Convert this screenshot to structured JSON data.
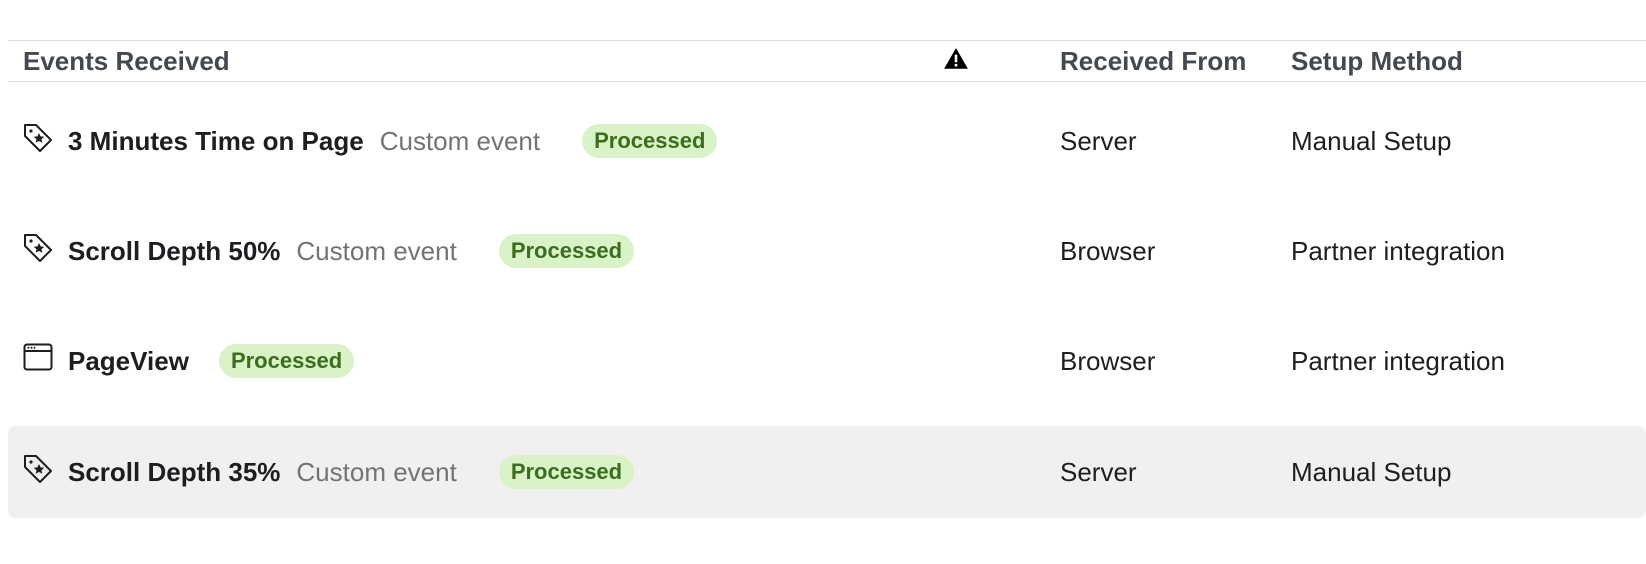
{
  "table": {
    "headers": {
      "events_received": "Events Received",
      "warning_icon": "warning-triangle-icon",
      "received_from": "Received From",
      "setup_method": "Setup Method"
    },
    "rows": [
      {
        "icon": "custom-event-tag-icon",
        "name": "3 Minutes Time on Page",
        "type": "Custom event",
        "status": "Processed",
        "received_from": "Server",
        "setup_method": "Manual Setup",
        "highlighted": false
      },
      {
        "icon": "custom-event-tag-icon",
        "name": "Scroll Depth 50%",
        "type": "Custom event",
        "status": "Processed",
        "received_from": "Browser",
        "setup_method": "Partner integration",
        "highlighted": false
      },
      {
        "icon": "browser-window-icon",
        "name": "PageView",
        "type": "",
        "status": "Processed",
        "received_from": "Browser",
        "setup_method": "Partner integration",
        "highlighted": false
      },
      {
        "icon": "custom-event-tag-icon",
        "name": "Scroll Depth 35%",
        "type": "Custom event",
        "status": "Processed",
        "received_from": "Server",
        "setup_method": "Manual Setup",
        "highlighted": true
      }
    ]
  },
  "colors": {
    "badge_bg": "#d9f2c7",
    "badge_text": "#3b6e1c",
    "highlight_row": "#f0f0f0"
  }
}
